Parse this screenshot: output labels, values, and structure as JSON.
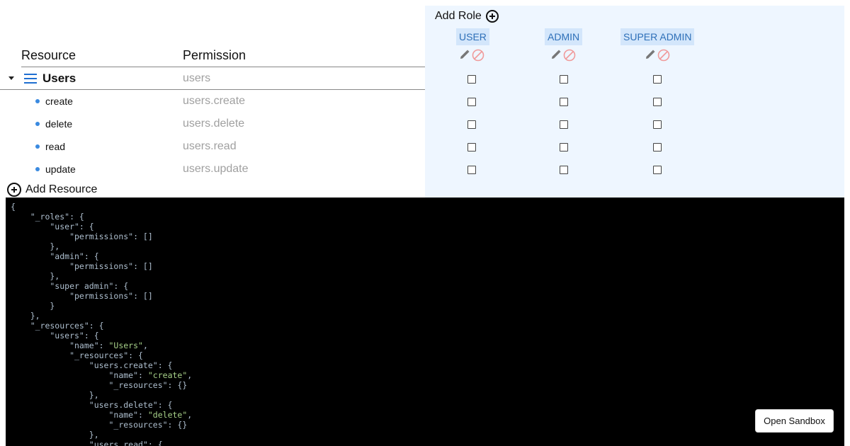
{
  "table": {
    "col_resource": "Resource",
    "col_permission": "Permission",
    "group": {
      "name": "Users",
      "permission": "users"
    },
    "items": [
      {
        "name": "create",
        "permission": "users.create"
      },
      {
        "name": "delete",
        "permission": "users.delete"
      },
      {
        "name": "read",
        "permission": "users.read"
      },
      {
        "name": "update",
        "permission": "users.update"
      }
    ],
    "add_resource_label": "Add Resource"
  },
  "roles": {
    "add_role_label": "Add Role",
    "list": [
      {
        "name": "USER"
      },
      {
        "name": "ADMIN"
      },
      {
        "name": "SUPER ADMIN"
      }
    ]
  },
  "code": {
    "lines": [
      "{",
      "    \"_roles\": {",
      "        \"user\": {",
      "            \"permissions\": []",
      "        },",
      "        \"admin\": {",
      "            \"permissions\": []",
      "        },",
      "        \"super admin\": {",
      "            \"permissions\": []",
      "        }",
      "    },",
      "    \"_resources\": {",
      "        \"users\": {",
      "            \"name\": \"Users\",",
      "            \"_resources\": {",
      "                \"users.create\": {",
      "                    \"name\": \"create\",",
      "                    \"_resources\": {}",
      "                },",
      "                \"users.delete\": {",
      "                    \"name\": \"delete\",",
      "                    \"_resources\": {}",
      "                },",
      "                \"users.read\": {"
    ]
  },
  "sandbox": {
    "label": "Open Sandbox"
  },
  "colors": {
    "accent": "#2d6fb8",
    "role_bg": "#d3e6fb",
    "panel_bg": "#eef6ff",
    "code_bg": "#000000",
    "string": "#a8d28a"
  },
  "icons": {
    "group": "menu-icon",
    "edit": "pencil-icon",
    "disable": "ban-icon",
    "add": "plus-circle-icon"
  }
}
